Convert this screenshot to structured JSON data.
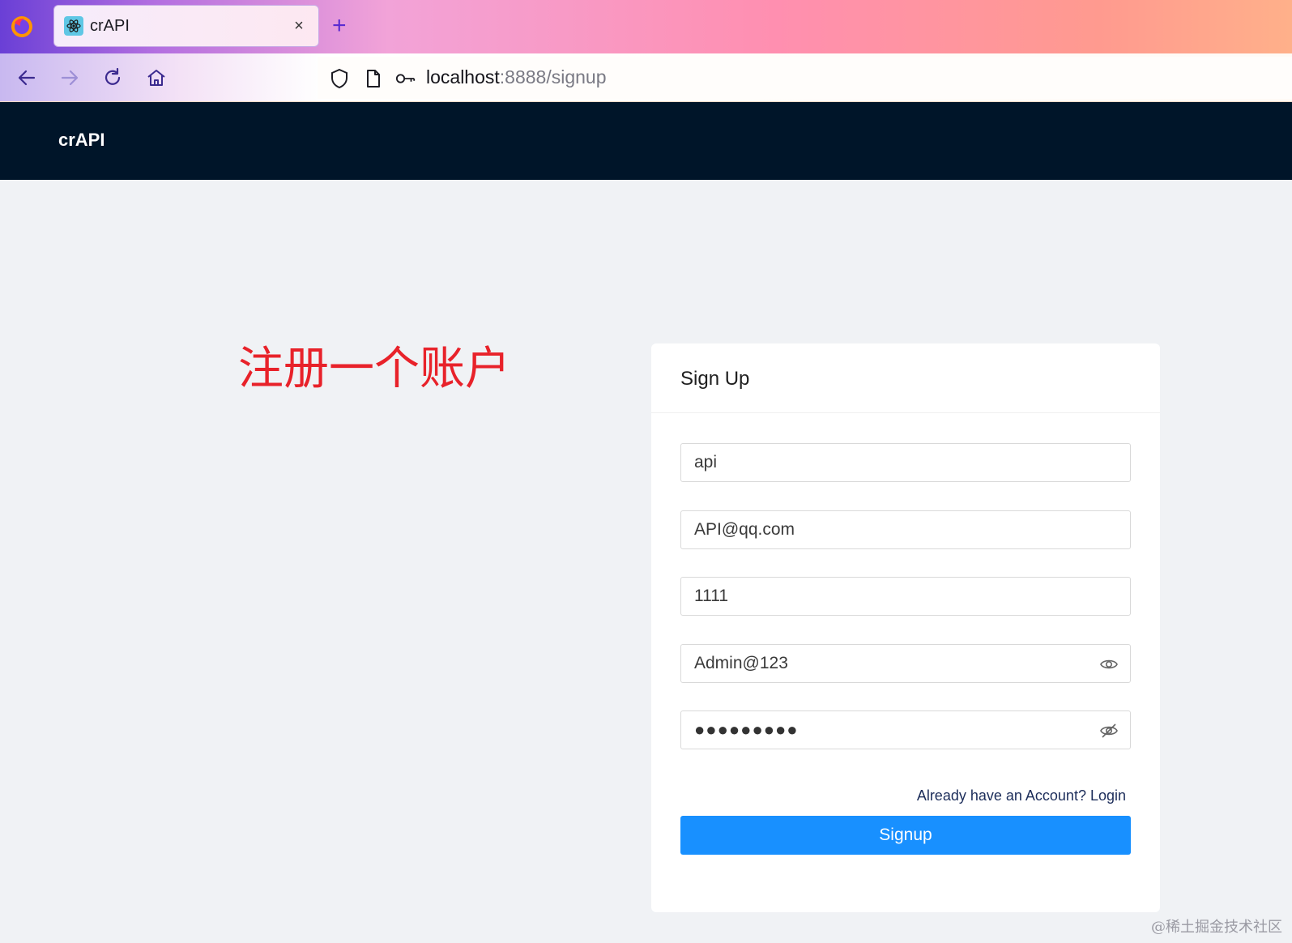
{
  "browser": {
    "tab_title": "crAPI",
    "tab_close": "×",
    "new_tab": "+",
    "url_host": "localhost",
    "url_rest": ":8888/signup"
  },
  "app": {
    "logo": "crAPI"
  },
  "annotation": "注册一个账户",
  "signup_card": {
    "title": "Sign Up",
    "name_value": "api",
    "email_value": "API@qq.com",
    "phone_value": "1111",
    "password_value": "Admin@123",
    "confirm_password_masked": "●●●●●●●●●",
    "login_link": "Already have an Account? Login",
    "submit_label": "Signup"
  },
  "watermark": "@稀土掘金技术社区",
  "colors": {
    "header_bg": "#001529",
    "primary": "#1890ff",
    "annotation": "#e8222a"
  }
}
